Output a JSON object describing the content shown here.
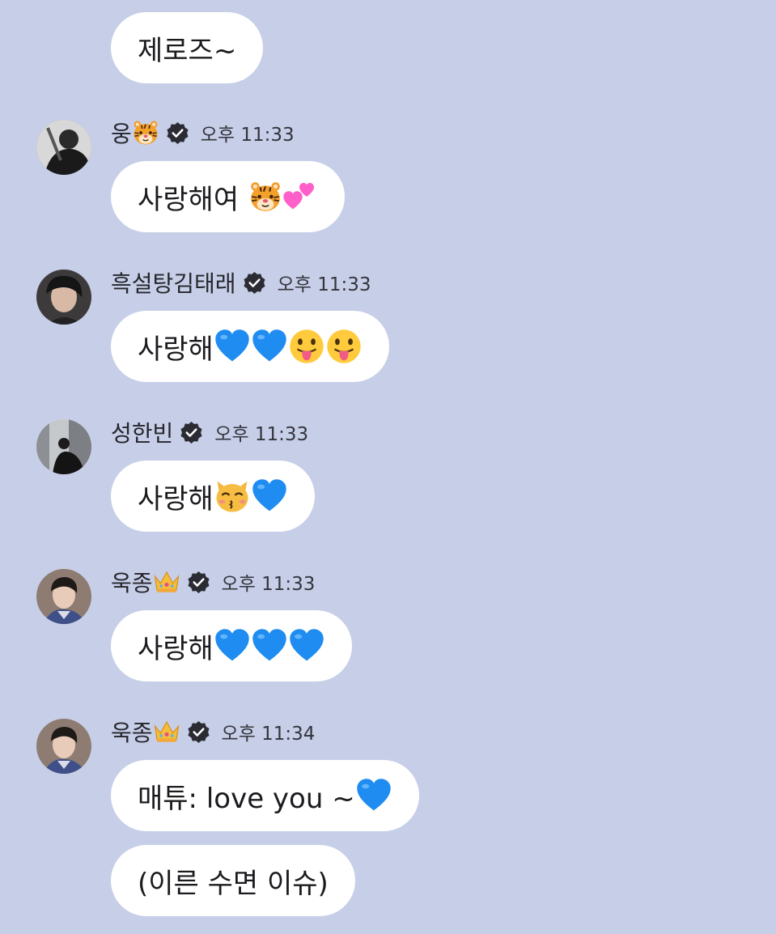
{
  "messages": [
    {
      "text": "제로즈~"
    },
    {
      "sender": "웅",
      "sender_emoji": "🐯",
      "time": "오후 11:33",
      "text": "사랑해여 ",
      "emojis": [
        "tiger-face",
        "two-hearts"
      ]
    },
    {
      "sender": "흑설탕김태래",
      "time": "오후 11:33",
      "text": "사랑해",
      "emojis": [
        "blue-heart",
        "blue-heart",
        "tongue-face",
        "tongue-face"
      ]
    },
    {
      "sender": "성한빈",
      "time": "오후 11:33",
      "text": "사랑해",
      "emojis": [
        "kissing-cat",
        "blue-heart"
      ]
    },
    {
      "sender": "욱종",
      "sender_emoji": "👑",
      "time": "오후 11:33",
      "text": "사랑해",
      "emojis": [
        "blue-heart",
        "blue-heart",
        "blue-heart"
      ]
    },
    {
      "sender": "욱종",
      "sender_emoji": "👑",
      "time": "오후 11:34",
      "text": "매튜: love you ~",
      "emojis": [
        "blue-heart"
      ]
    },
    {
      "text": "(이른 수면 이슈)"
    }
  ],
  "colors": {
    "background": "#c7cfe8",
    "bubble": "#ffffff",
    "verified": "#2b2b33"
  }
}
